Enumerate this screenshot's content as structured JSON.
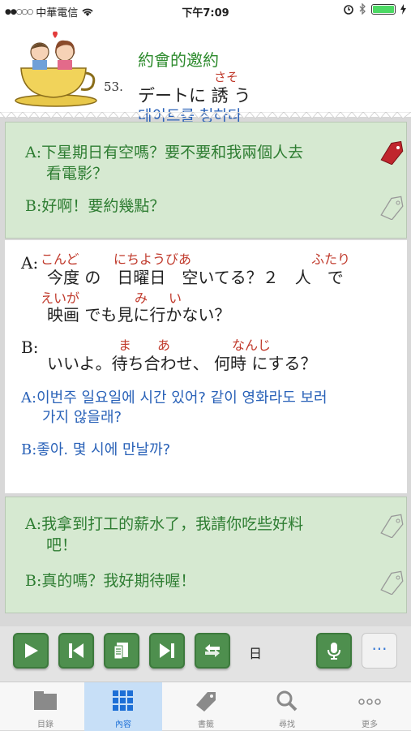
{
  "status": {
    "carrier": "中華電信",
    "time": "下午7:09"
  },
  "lesson": {
    "number": "53.",
    "title_zh": "約會的邀約",
    "title_jp": "デートに 誘 う",
    "title_jp_ruby": "さそ",
    "title_ko": "데이트를 청하다"
  },
  "card1": {
    "a_label": "A:",
    "a_line1": "下星期日有空嗎？要不要和我兩個人去",
    "a_line2": "看電影？",
    "b_label": "B:",
    "b_text": "好啊！要約幾點？"
  },
  "detail": {
    "a_label": "A:",
    "jp_line1": "今度 の　日曜日　空いてる？２　人　で",
    "jp_line2": "映画 でも見に行かない？",
    "ruby_1": "こんど",
    "ruby_2": "にちようびあ",
    "ruby_3": "ふたり",
    "ruby_4": "えいが",
    "ruby_5": "み",
    "ruby_6": "い",
    "b_label": "B:",
    "jp_b": "いいよ。待ち合わせ、 何時 にする？",
    "ruby_7": "ま",
    "ruby_8": "あ",
    "ruby_9": "なんじ",
    "ko_a_label": "A:",
    "ko_a1": "이번주 일요일에 시간 있어? 같이 영화라도 보러",
    "ko_a2": "가지 않을래?",
    "ko_b_label": "B:",
    "ko_b": "좋아. 몇 시에 만날까?"
  },
  "card2": {
    "a_label": "A:",
    "a_line1": "我拿到打工的薪水了，我請你吃些好料",
    "a_line2": "吧！",
    "b_label": "B:",
    "b_text": "真的嗎？我好期待喔！"
  },
  "controls": {
    "lang_label": "日",
    "more_label": "···"
  },
  "tabs": [
    {
      "label": "目錄"
    },
    {
      "label": "內容"
    },
    {
      "label": "書籤"
    },
    {
      "label": "尋找"
    },
    {
      "label": "更多"
    }
  ],
  "colors": {
    "accent_green": "#4e8f4e",
    "tab_active": "#1d6fd6",
    "korean_blue": "#2a62b8",
    "ruby_red": "#c0392b"
  }
}
